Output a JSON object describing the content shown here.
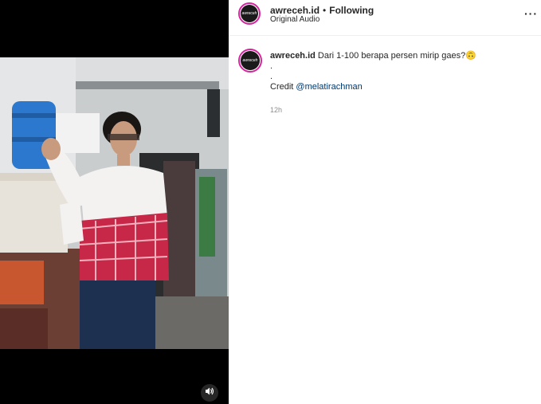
{
  "post": {
    "username": "awreceh.id",
    "separator": "•",
    "follow_status": "Following",
    "audio_label": "Original Audio",
    "more_label": "···",
    "caption_username": "awreceh.id",
    "caption_text": "Dari 1-100 berapa persen mirip gaes?",
    "caption_emoji": "🙃",
    "caption_dot1": ".",
    "caption_dot2": ".",
    "credit_label": "Credit",
    "credit_mention": "@melatirachman",
    "timestamp": "12h"
  },
  "colors": {
    "avatar_ring": "#d6249f",
    "link": "#00376b",
    "meta": "#8e8e8e"
  },
  "icons": {
    "mute": "speaker-icon",
    "more": "more-options-icon"
  }
}
